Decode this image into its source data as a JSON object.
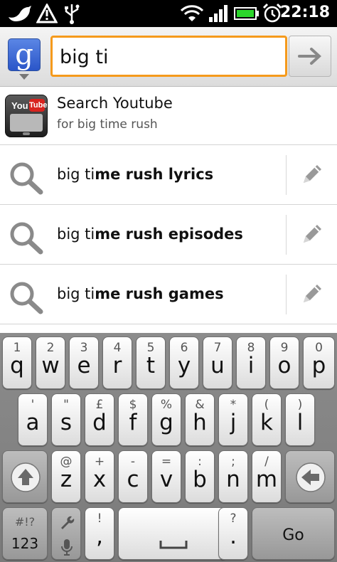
{
  "status_bar": {
    "time": "22:18",
    "icons": [
      "bird-icon",
      "warning-icon",
      "usb-icon",
      "wifi-icon",
      "signal-icon",
      "battery-icon",
      "alarm-icon"
    ]
  },
  "search": {
    "logo_letter": "g",
    "query": "big ti",
    "go_icon": "arrow-right-icon"
  },
  "suggestions": {
    "youtube": {
      "title": "Search Youtube",
      "subtitle": "for big time rush",
      "icon_you": "You",
      "icon_tube": "Tube"
    },
    "queries": [
      {
        "typed": "big ti",
        "completion": "me rush lyrics"
      },
      {
        "typed": "big ti",
        "completion": "me rush episodes"
      },
      {
        "typed": "big ti",
        "completion": "me rush games"
      }
    ]
  },
  "keyboard": {
    "row1": [
      {
        "sec": "1",
        "pri": "q"
      },
      {
        "sec": "2",
        "pri": "w"
      },
      {
        "sec": "3",
        "pri": "e"
      },
      {
        "sec": "4",
        "pri": "r"
      },
      {
        "sec": "5",
        "pri": "t"
      },
      {
        "sec": "6",
        "pri": "y"
      },
      {
        "sec": "7",
        "pri": "u"
      },
      {
        "sec": "8",
        "pri": "i"
      },
      {
        "sec": "9",
        "pri": "o"
      },
      {
        "sec": "0",
        "pri": "p"
      }
    ],
    "row2": [
      {
        "sec": "'",
        "pri": "a"
      },
      {
        "sec": "\"",
        "pri": "s"
      },
      {
        "sec": "£",
        "pri": "d"
      },
      {
        "sec": "$",
        "pri": "f"
      },
      {
        "sec": "%",
        "pri": "g"
      },
      {
        "sec": "&",
        "pri": "h"
      },
      {
        "sec": "*",
        "pri": "j"
      },
      {
        "sec": "(",
        "pri": "k"
      },
      {
        "sec": ")",
        "pri": "l"
      }
    ],
    "row3": [
      {
        "sec": "@",
        "pri": "z"
      },
      {
        "sec": "+",
        "pri": "x"
      },
      {
        "sec": "-",
        "pri": "c"
      },
      {
        "sec": "=",
        "pri": "v"
      },
      {
        "sec": ":",
        "pri": "b"
      },
      {
        "sec": ";",
        "pri": "n"
      },
      {
        "sec": "/",
        "pri": "m"
      }
    ],
    "sym_top": "#!?",
    "sym_bottom": "123",
    "comma_sec": "!",
    "comma_pri": ",",
    "period_sec": "?",
    "period_pri": ".",
    "go_label": "Go"
  }
}
